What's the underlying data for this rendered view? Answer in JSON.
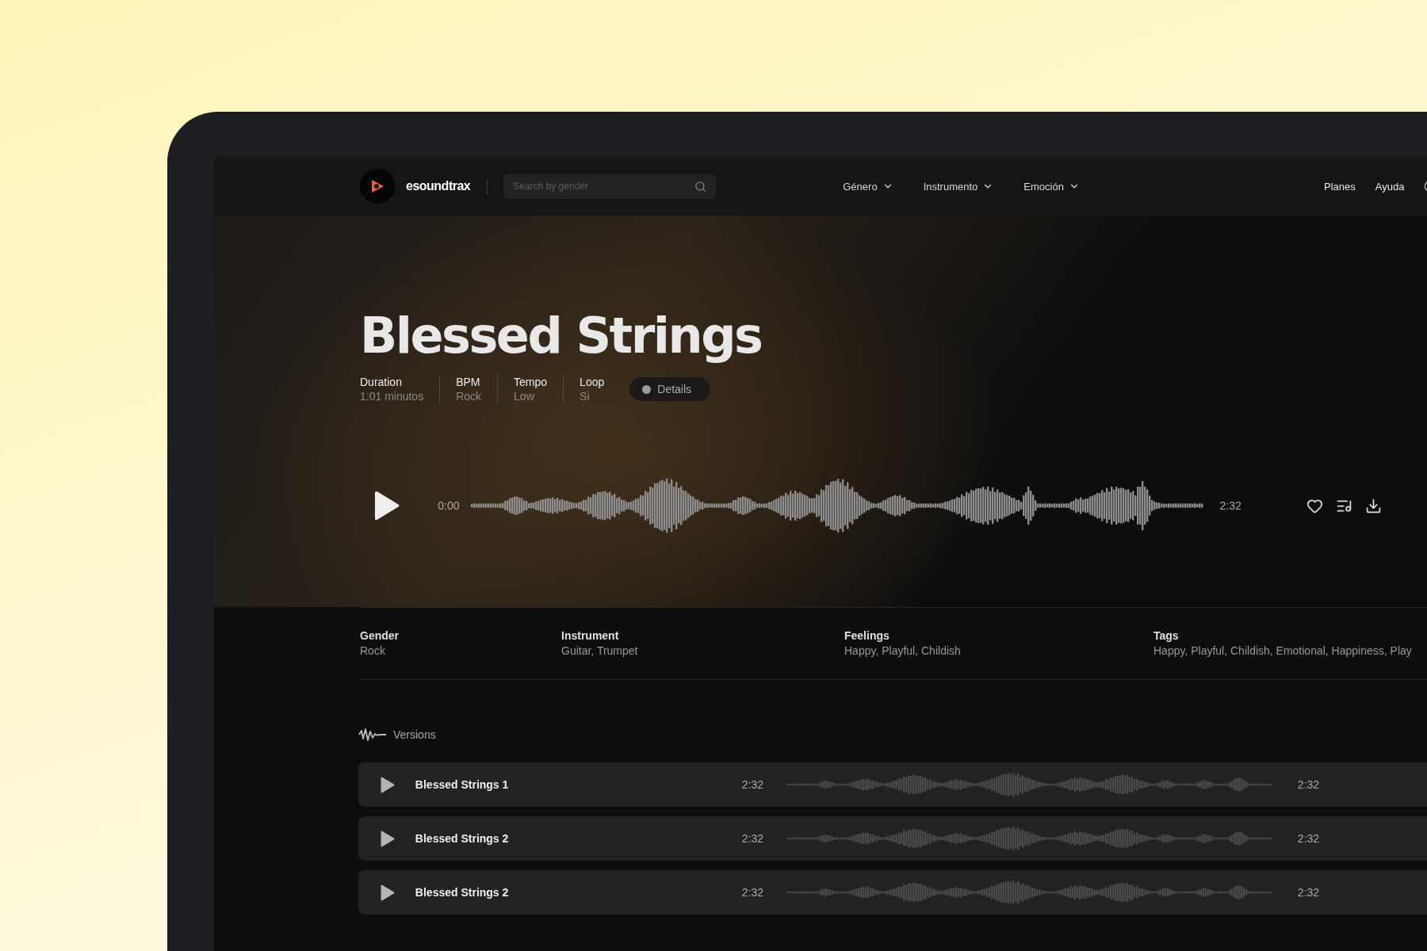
{
  "nav": {
    "brand": "esoundtrax",
    "search": {
      "placeholder": "Search by gender"
    },
    "menus": [
      {
        "label": "Género"
      },
      {
        "label": "Instrumento"
      },
      {
        "label": "Emoción"
      }
    ],
    "links": [
      "Planes",
      "Ayuda"
    ]
  },
  "track": {
    "title": "Blessed Strings",
    "meta": [
      {
        "label": "Duration",
        "value": "1:01 minutos"
      },
      {
        "label": "BPM",
        "value": "Rock"
      },
      {
        "label": "Tempo",
        "value": "Low"
      },
      {
        "label": "Loop",
        "value": "Si"
      }
    ],
    "details": "Details",
    "player": {
      "start": "0:00",
      "end": "2:32"
    }
  },
  "info": [
    {
      "label": "Gender",
      "value": "Rock"
    },
    {
      "label": "Instrument",
      "value": "Guitar, Trumpet"
    },
    {
      "label": "Feelings",
      "value": "Happy, Playful, Childish"
    },
    {
      "label": "Tags",
      "value": "Happy, Playful, Childish, Emotional, Happiness, Play"
    }
  ],
  "versions": {
    "title": "Versions",
    "rows": [
      {
        "name": "Blessed Strings 1",
        "duration": "2:32",
        "end": "2:32"
      },
      {
        "name": "Blessed Strings 2",
        "duration": "2:32",
        "end": "2:32"
      },
      {
        "name": "Blessed Strings 2",
        "duration": "2:32",
        "end": "2:32"
      }
    ]
  }
}
